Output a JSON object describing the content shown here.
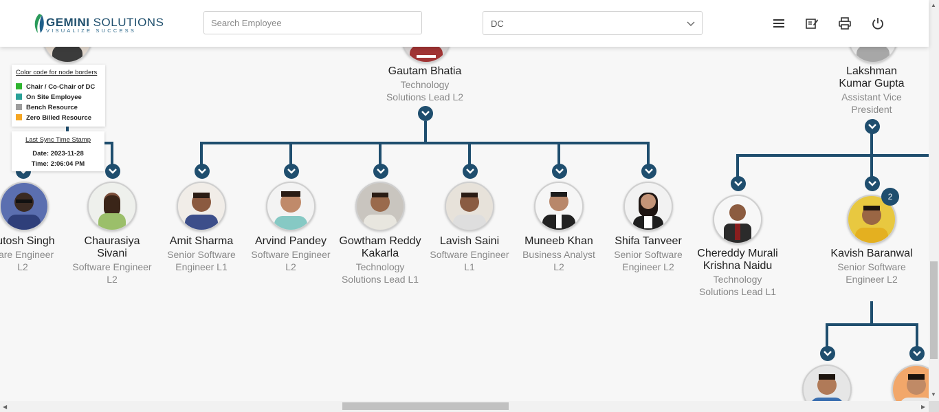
{
  "header": {
    "logo_name": "GEMINI",
    "logo_suffix": " SOLUTIONS",
    "logo_tagline": "VISUALIZE SUCCESS",
    "search_placeholder": "Search Employee",
    "dc_selected": "DC",
    "icons": [
      "menu-icon",
      "edit-note-icon",
      "print-icon",
      "power-icon"
    ]
  },
  "legend": {
    "title": "Color code for node borders",
    "items": [
      {
        "label": "Chair / Co-Chair of DC",
        "color": "#2fb52f"
      },
      {
        "label": "On Site Employee",
        "color": "#2aa198"
      },
      {
        "label": "Bench Resource",
        "color": "#9e9e9e"
      },
      {
        "label": "Zero Billed Resource",
        "color": "#f5a623"
      }
    ]
  },
  "sync": {
    "title": "Last Sync Time Stamp",
    "date": "Date: 2023-11-28",
    "time": "Time: 2:06:04 PM"
  },
  "managers": [
    {
      "name": "Gautam Bhatia",
      "role1": "Technology",
      "role2": "Solutions Lead L2"
    },
    {
      "name1": "Lakshman",
      "name2": "Kumar Gupta",
      "role1": "Assistant Vice",
      "role2": "President"
    }
  ],
  "employees": [
    {
      "name1": "hutosh Singh",
      "role1": "ware Engineer",
      "role2": "L2"
    },
    {
      "name1": "Chaurasiya",
      "name2": "Sivani",
      "role1": "Software Engineer",
      "role2": "L2"
    },
    {
      "name1": "Amit Sharma",
      "role1": "Senior Software",
      "role2": "Engineer L1"
    },
    {
      "name1": "Arvind Pandey",
      "role1": "Software Engineer",
      "role2": "L2"
    },
    {
      "name1": "Gowtham Reddy",
      "name2": "Kakarla",
      "role1": "Technology",
      "role2": "Solutions Lead L1"
    },
    {
      "name1": "Lavish Saini",
      "role1": "Software Engineer",
      "role2": "L1"
    },
    {
      "name1": "Muneeb Khan",
      "role1": "Business Analyst",
      "role2": "L2"
    },
    {
      "name1": "Shifa Tanveer",
      "role1": "Senior Software",
      "role2": "Engineer L2"
    },
    {
      "name1": "Chereddy Murali",
      "name2": "Krishna Naidu",
      "role1": "Technology",
      "role2": "Solutions Lead L1"
    },
    {
      "name1": "Kavish Baranwal",
      "role1": "Senior Software",
      "role2": "Engineer L2",
      "badge": "2"
    }
  ]
}
